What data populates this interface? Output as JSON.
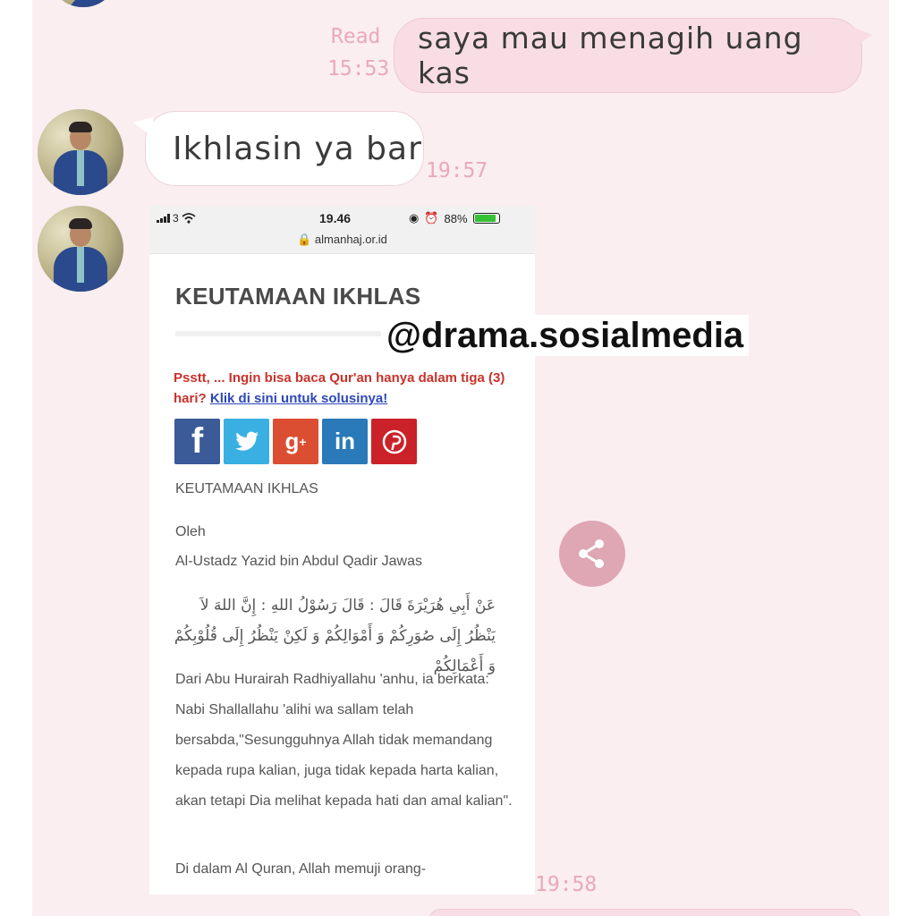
{
  "chat": {
    "messages": [
      {
        "text": "saya mau menagih uang kas",
        "status": "Read",
        "time": "15:53"
      },
      {
        "text": "Ikhlasin ya bar",
        "time": "19:57"
      }
    ],
    "image_time": "19:58"
  },
  "shared_screenshot": {
    "status_bar": {
      "signal": "3",
      "time": "19.46",
      "battery": "88%",
      "url": "almanhaj.or.id"
    },
    "title": "KEUTAMAAN IKHLAS",
    "promo_text": "Psstt, ... Ingin bisa baca Qur'an hanya dalam tiga (3) hari?",
    "promo_link": "Klik di sini untuk solusinya!",
    "social": [
      "f",
      "twitter",
      "g+",
      "in",
      "pinterest"
    ],
    "subtitle": "KEUTAMAAN IKHLAS",
    "by_label": "Oleh",
    "author": "Al-Ustadz Yazid bin Abdul Qadir Jawas",
    "arabic": "عَنْ أَبِي هُرَيْرَةَ قَالَ : قَالَ رَسُوْلُ اللهِ : إِنَّ اللهَ لاَ يَنْظُرُ إِلَى صُوَرِكُمْ وَ أَمْوَالِكُمْ وَ لَكِنْ يَنْظُرُ إِلَى قُلُوْبِكُمْ وَ أَعْمَالِكُمْ",
    "paragraph": "Dari Abu Hurairah Radhiyallahu 'anhu, ia berkata: Nabi Shallallahu 'alihi wa sallam telah bersabda,\"Sesungguhnya Allah tidak memandang kepada rupa kalian, juga tidak kepada harta kalian, akan tetapi Dia melihat kepada hati dan amal kalian\".",
    "paragraph2": "Di dalam Al Quran, Allah memuji orang-"
  },
  "watermark": "@drama.sosialmedia",
  "colors": {
    "chat_bg": "#fbeef1",
    "outgoing_bubble": "#f8dde4",
    "meta_text": "#e9a9b9",
    "share_button": "#dfa6b4"
  },
  "icons": [
    "share-icon",
    "wifi-icon",
    "lock-icon",
    "battery-icon"
  ]
}
